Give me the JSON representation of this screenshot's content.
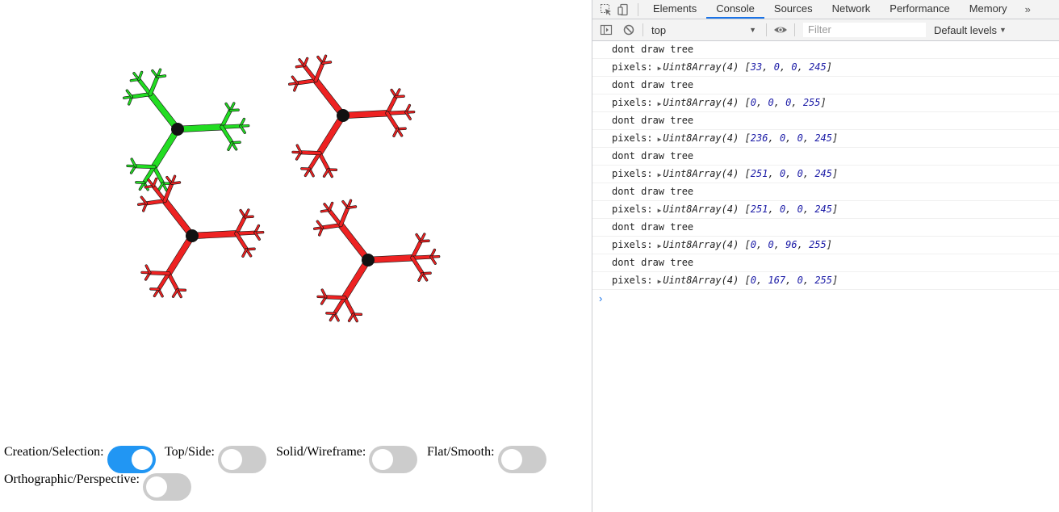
{
  "app": {
    "toggles": [
      {
        "label": "Creation/Selection:",
        "on": true
      },
      {
        "label": "Top/Side:",
        "on": false
      },
      {
        "label": "Solid/Wireframe:",
        "on": false
      },
      {
        "label": "Flat/Smooth:",
        "on": false
      },
      {
        "label": "Orthographic/Perspective:",
        "on": false
      }
    ],
    "trees": [
      {
        "color": "green"
      },
      {
        "color": "red"
      },
      {
        "color": "red"
      },
      {
        "color": "red"
      }
    ]
  },
  "devtools": {
    "tabs": [
      "Elements",
      "Console",
      "Sources",
      "Network",
      "Performance",
      "Memory"
    ],
    "active_tab": "Console",
    "more": "»",
    "context": "top",
    "filter_placeholder": "Filter",
    "levels": "Default levels",
    "messages": [
      {
        "text": "dont draw tree"
      },
      {
        "prefix": "pixels:",
        "type": "Uint8Array(4)",
        "values": [
          33,
          0,
          0,
          245
        ]
      },
      {
        "text": "dont draw tree"
      },
      {
        "prefix": "pixels:",
        "type": "Uint8Array(4)",
        "values": [
          0,
          0,
          0,
          255
        ]
      },
      {
        "text": "dont draw tree"
      },
      {
        "prefix": "pixels:",
        "type": "Uint8Array(4)",
        "values": [
          236,
          0,
          0,
          245
        ]
      },
      {
        "text": "dont draw tree"
      },
      {
        "prefix": "pixels:",
        "type": "Uint8Array(4)",
        "values": [
          251,
          0,
          0,
          245
        ]
      },
      {
        "text": "dont draw tree"
      },
      {
        "prefix": "pixels:",
        "type": "Uint8Array(4)",
        "values": [
          251,
          0,
          0,
          245
        ]
      },
      {
        "text": "dont draw tree"
      },
      {
        "prefix": "pixels:",
        "type": "Uint8Array(4)",
        "values": [
          0,
          0,
          96,
          255
        ]
      },
      {
        "text": "dont draw tree"
      },
      {
        "prefix": "pixels:",
        "type": "Uint8Array(4)",
        "values": [
          0,
          167,
          0,
          255
        ]
      }
    ],
    "prompt_symbol": "›"
  },
  "colors": {
    "toggle_on": "#2196f3",
    "toggle_off": "#cccccc",
    "tree_green": "#22dd22",
    "tree_red": "#ee2222",
    "tree_dark": "#111111",
    "accent": "#1a73e8",
    "number": "#1a1aa6"
  }
}
